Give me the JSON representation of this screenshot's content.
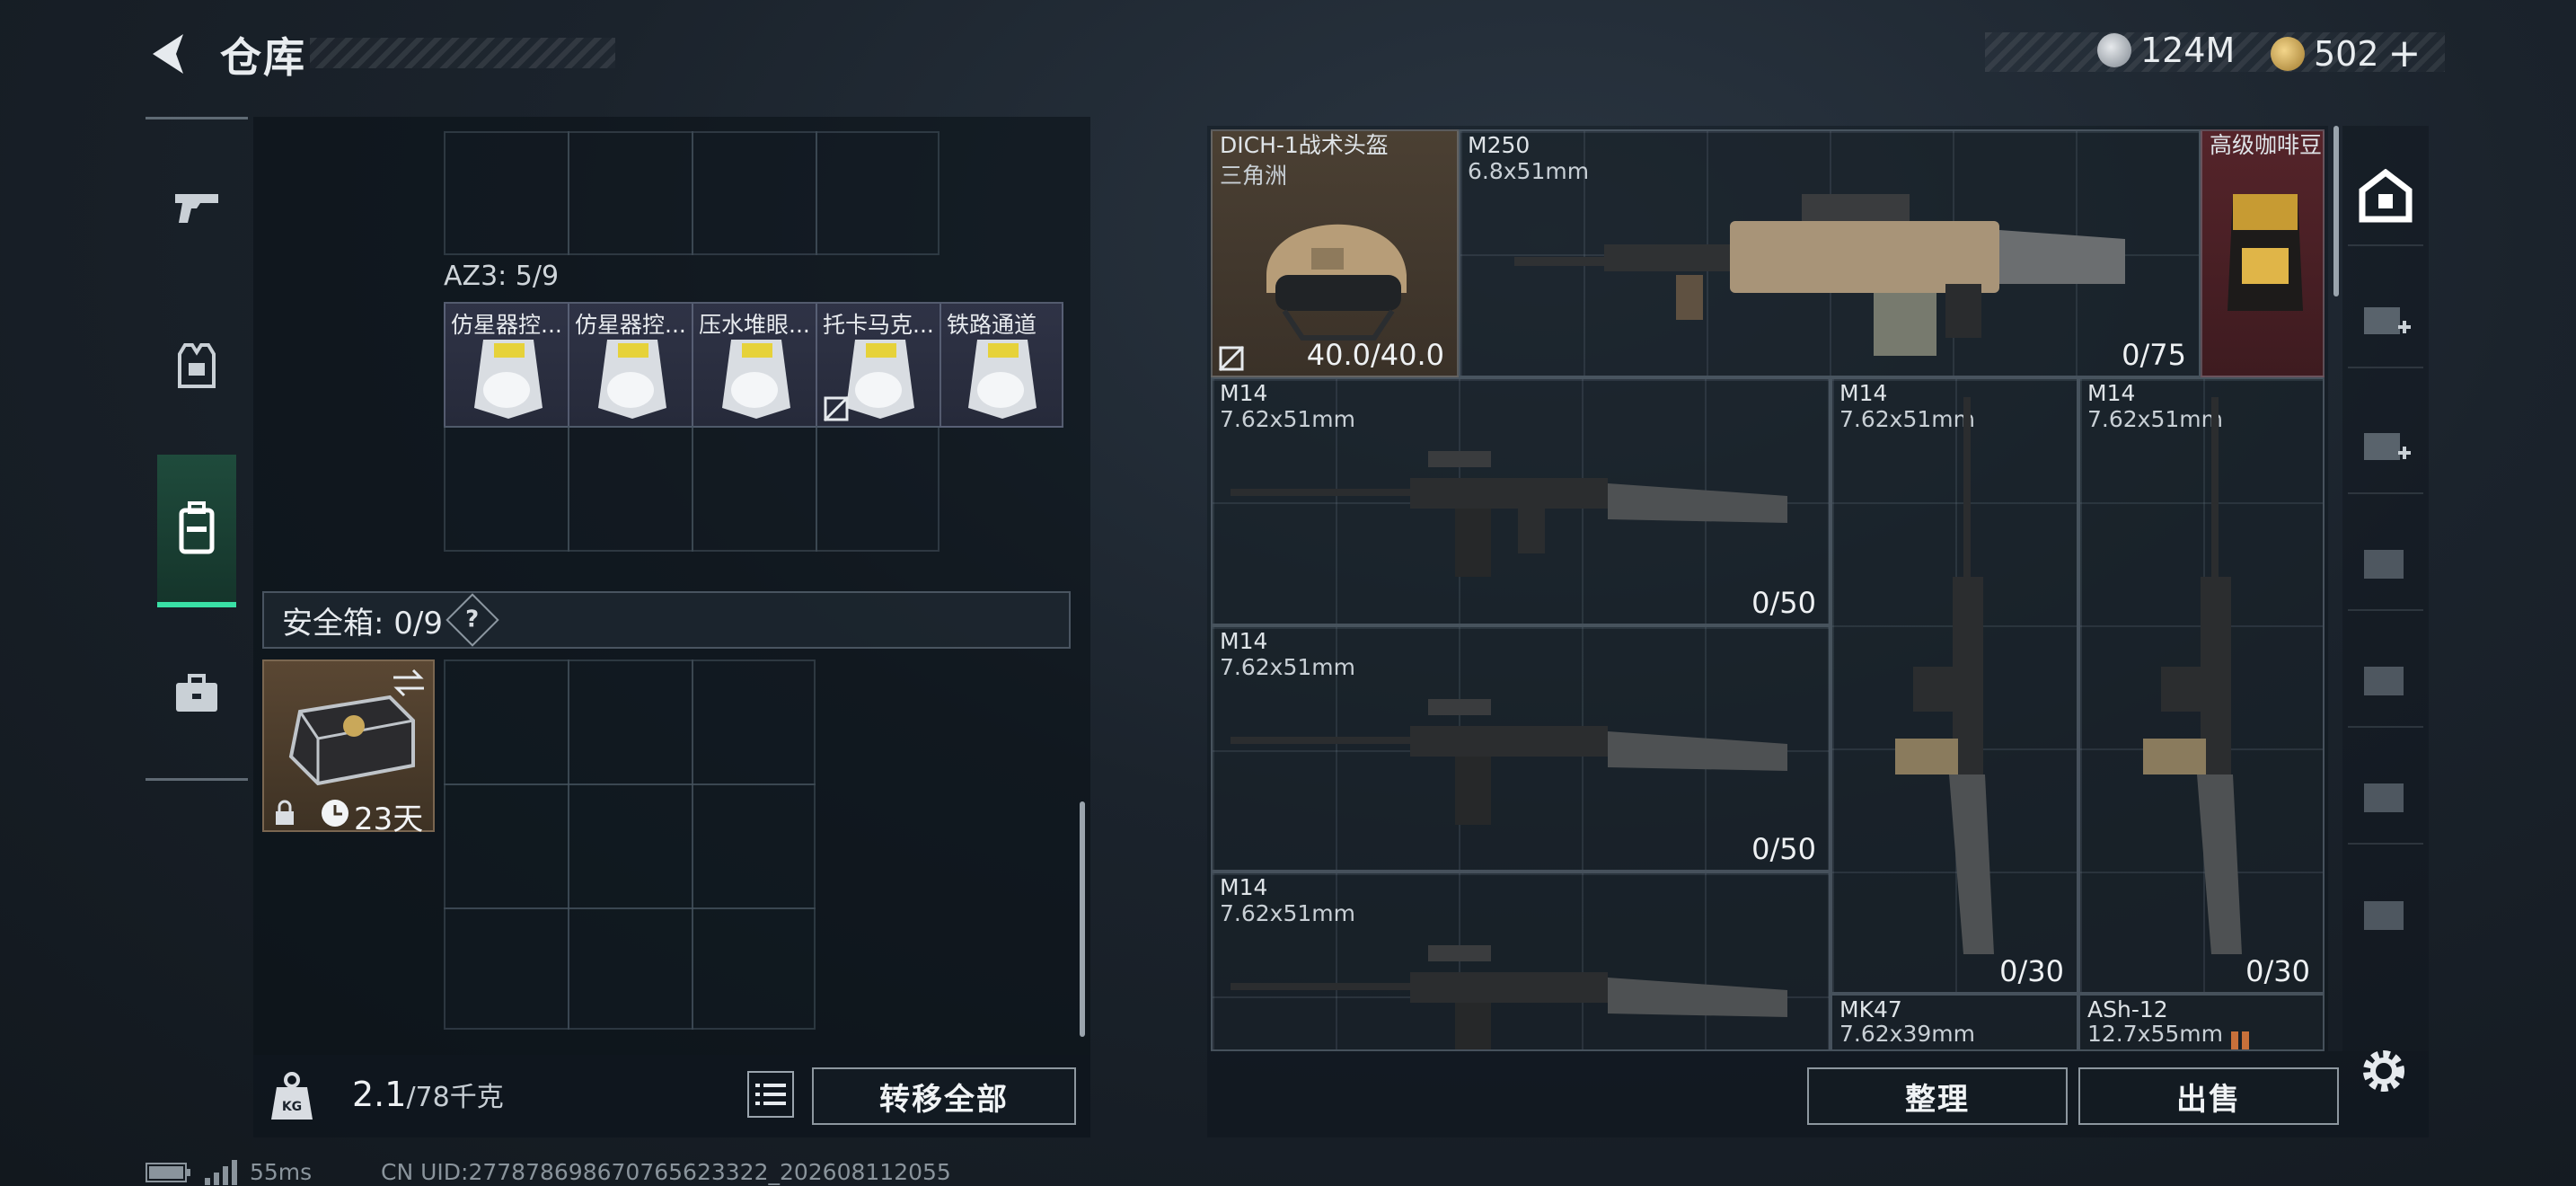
{
  "header": {
    "title": "仓库",
    "currency_1": "124M",
    "currency_2": "502",
    "add_symbol": "+"
  },
  "left": {
    "container_label": "AZ3: 5/9",
    "items": [
      {
        "label": "仿星器控..."
      },
      {
        "label": "仿星器控..."
      },
      {
        "label": "压水堆眼..."
      },
      {
        "label": "托卡马克..."
      },
      {
        "label": "铁路通道"
      }
    ],
    "safebox_label": "安全箱: 0/9",
    "safebox_help": "?",
    "safebox_timer": "23天",
    "weight_value": "2.1",
    "weight_max": "/78千克",
    "transfer_all": "转移全部"
  },
  "right": {
    "slots": [
      {
        "name": "DICH-1战术头盔",
        "sub": "三角洲",
        "count": "40.0/40.0"
      },
      {
        "name": "M250",
        "sub": "6.8x51mm",
        "count": "0/75"
      },
      {
        "name": "高级咖啡豆",
        "sub": "",
        "count": ""
      },
      {
        "name": "M14",
        "sub": "7.62x51mm",
        "count": "0/50"
      },
      {
        "name": "M14",
        "sub": "7.62x51mm",
        "count": "0/30"
      },
      {
        "name": "M14",
        "sub": "7.62x51mm",
        "count": "0/30"
      },
      {
        "name": "M14",
        "sub": "7.62x51mm",
        "count": "0/50"
      },
      {
        "name": "M14",
        "sub": "7.62x51mm",
        "count": ""
      },
      {
        "name": "MK47",
        "sub": "7.62x39mm",
        "count": ""
      },
      {
        "name": "ASh-12",
        "sub": "12.7x55mm",
        "count": ""
      }
    ],
    "sort_button": "整理",
    "sell_button": "出售"
  },
  "footer": {
    "ping": "55ms",
    "uid": "CN UID:277878698670765623322_202608112055"
  },
  "colors": {
    "accent": "#39e0a5",
    "coffee_bg": "#55242a",
    "helmet_bg": "#4b4033"
  }
}
